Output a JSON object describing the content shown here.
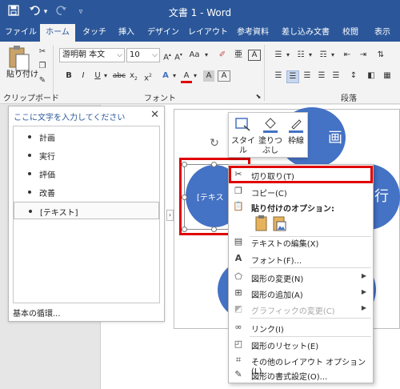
{
  "window": {
    "title": "文書 1 - Word"
  },
  "qat": {
    "save_icon": "save-icon",
    "undo_icon": "undo-icon",
    "redo_icon": "redo-icon",
    "customize_icon": "customize-qat-icon"
  },
  "tabs": [
    "ファイル",
    "ホーム",
    "タッチ",
    "挿入",
    "デザイン",
    "レイアウト",
    "参考資料",
    "差し込み文書",
    "校閲",
    "表示"
  ],
  "active_tab": "ホーム",
  "ribbon": {
    "paste_label": "貼り付け",
    "clipboard_group": "クリップボード",
    "font_name": "游明朝 本文",
    "font_size": "10",
    "font_group": "フォント",
    "paragraph_group": "段落"
  },
  "text_pane": {
    "title": "ここに文字を入力してください",
    "items": [
      "計画",
      "実行",
      "評価",
      "改善",
      "[テキスト]"
    ],
    "footer": "基本の循環..."
  },
  "smartart": {
    "shape_text_left": "[テキス",
    "shape_text_right": "行",
    "shape_text_top": "画",
    "accent_color": "#4472c4"
  },
  "mini_toolbar": {
    "style_label": "スタイル",
    "fill_label": "塗りつぶし",
    "outline_label": "枠線"
  },
  "context_menu": {
    "items": [
      {
        "label": "切り取り(T)",
        "icon": "scissors-icon"
      },
      {
        "label": "コピー(C)",
        "icon": "copy-icon"
      },
      {
        "label": "貼り付けのオプション:",
        "icon": "paste-icon"
      },
      {
        "label": "テキストの編集(X)",
        "icon": "edit-text-icon"
      },
      {
        "label": "フォント(F)...",
        "icon": "font-icon"
      },
      {
        "label": "図形の変更(N)",
        "icon": "change-shape-icon"
      },
      {
        "label": "図形の追加(A)",
        "icon": "add-shape-icon"
      },
      {
        "label": "グラフィックの変更(C)",
        "icon": "change-graphic-icon"
      },
      {
        "label": "リンク(I)",
        "icon": "link-icon"
      },
      {
        "label": "図形のリセット(E)",
        "icon": "reset-shape-icon"
      },
      {
        "label": "その他のレイアウト オプション(L)...",
        "icon": "layout-options-icon"
      },
      {
        "label": "図形の書式設定(O)...",
        "icon": "format-shape-icon"
      }
    ]
  },
  "colors": {
    "title_bar": "#2b579a",
    "highlight": "#e00000"
  }
}
